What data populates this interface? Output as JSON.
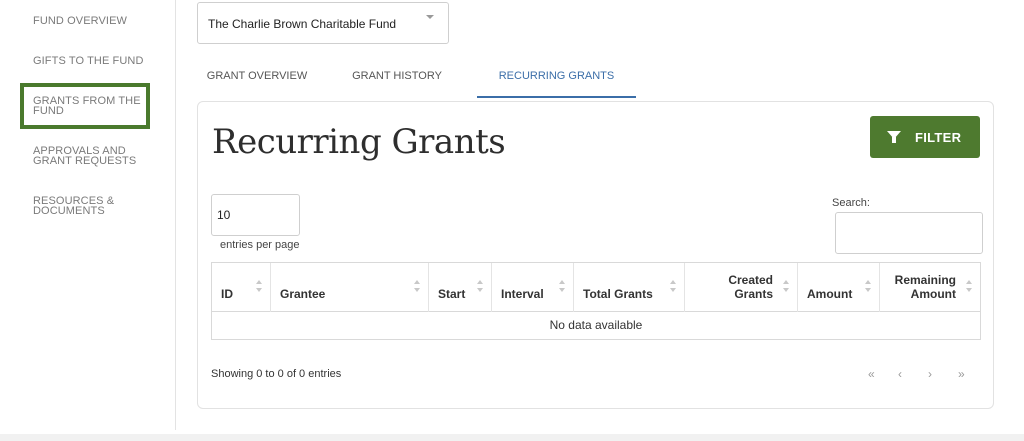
{
  "sidebar": {
    "items": [
      {
        "label": "FUND OVERVIEW"
      },
      {
        "label": "GIFTS TO THE FUND"
      },
      {
        "label": "GRANTS FROM THE FUND"
      },
      {
        "label": "APPROVALS AND GRANT REQUESTS"
      },
      {
        "label": "RESOURCES & DOCUMENTS"
      }
    ],
    "active_index": 2
  },
  "fund_selector": {
    "selected": "The Charlie Brown Charitable Fund",
    "icon": "chevron-down-icon"
  },
  "tabs": [
    {
      "label": "GRANT OVERVIEW"
    },
    {
      "label": "GRANT HISTORY"
    },
    {
      "label": "RECURRING GRANTS"
    }
  ],
  "active_tab": 2,
  "card": {
    "title": "Recurring Grants",
    "filter_label": "FILTER",
    "filter_icon": "filter-icon"
  },
  "table_controls": {
    "length_value": "10",
    "length_label": "entries per page",
    "search_label": "Search:",
    "search_value": ""
  },
  "table": {
    "columns": [
      {
        "label": "ID"
      },
      {
        "label": "Grantee"
      },
      {
        "label": "Start"
      },
      {
        "label": "Interval"
      },
      {
        "label": "Total Grants"
      },
      {
        "label": "Created Grants"
      },
      {
        "label": "Amount"
      },
      {
        "label": "Remaining Amount"
      }
    ],
    "empty_message": "No data available"
  },
  "footer": {
    "info": "Showing 0 to 0 of 0 entries",
    "pager": {
      "first": "«",
      "prev": "‹",
      "next": "›",
      "last": "»"
    }
  },
  "colors": {
    "accent_green": "#4e7a2f",
    "active_tab_blue": "#3b6ea8"
  }
}
